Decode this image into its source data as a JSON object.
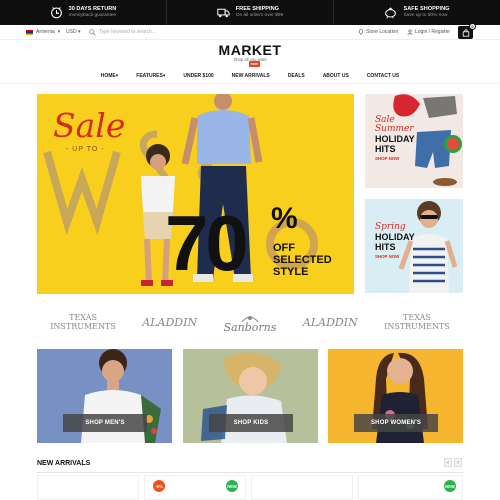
{
  "topbar": {
    "items": [
      {
        "title": "30 DAYS RETURN",
        "subtitle": "moneyback guarantee",
        "icon": "clock-icon"
      },
      {
        "title": "FREE SHIPPING",
        "subtitle": "On all orders over $99",
        "icon": "truck-icon"
      },
      {
        "title": "SAFE SHOPPING",
        "subtitle": "Save up to 50% now",
        "icon": "piggy-bank-icon"
      }
    ]
  },
  "utility": {
    "language": "Armenia",
    "currency": "USD",
    "search_placeholder": "Type keyword to search...",
    "store_location": "Store Location",
    "login_register": "Login / Register",
    "cart_count": "0"
  },
  "logo": {
    "name": "MARKET",
    "tagline": "Shop all you want"
  },
  "nav": {
    "items": [
      "HOME",
      "FEATURES",
      "UNDER $100",
      "NEW ARRIVALS",
      "DEALS",
      "ABOUT US",
      "CONTACT US"
    ],
    "new_badge": "new"
  },
  "hero": {
    "sale": "Sale",
    "up_to": "- UP TO -",
    "percent": "70",
    "percent_sign": "%",
    "offer_line1": "OFF SELECTED",
    "offer_line2": "STYLE"
  },
  "side_banners": [
    {
      "script": "Sale",
      "script2": "Summer",
      "heading1": "HOLIDAY",
      "heading2": "HITS",
      "cta": "SHOP NOW"
    },
    {
      "script": "Spring",
      "heading1": "HOLIDAY",
      "heading2": "HITS",
      "cta": "SHOP NOW"
    }
  ],
  "brands": [
    {
      "line1": "TEXAS",
      "line2": "INSTRUMENTS"
    },
    {
      "line1": "ALADDIN",
      "line2": ""
    },
    {
      "line1": "Sanborns",
      "line2": ""
    },
    {
      "line1": "ALADDIN",
      "line2": ""
    },
    {
      "line1": "TEXAS",
      "line2": "INSTRUMENTS"
    }
  ],
  "categories": [
    {
      "label": "SHOP MEN'S"
    },
    {
      "label": "SHOP KIDS"
    },
    {
      "label": "SHOP WOMEN'S"
    }
  ],
  "new_arrivals": {
    "title": "NEW ARRIVALS",
    "prev": "‹",
    "next": "›",
    "badges": [
      "-9%",
      "NEW",
      "NEW"
    ]
  },
  "colors": {
    "accent_red": "#e4432d",
    "hero_yellow": "#f9cf1e",
    "new_green": "#2bb24c",
    "sale_orange": "#f0501e"
  }
}
